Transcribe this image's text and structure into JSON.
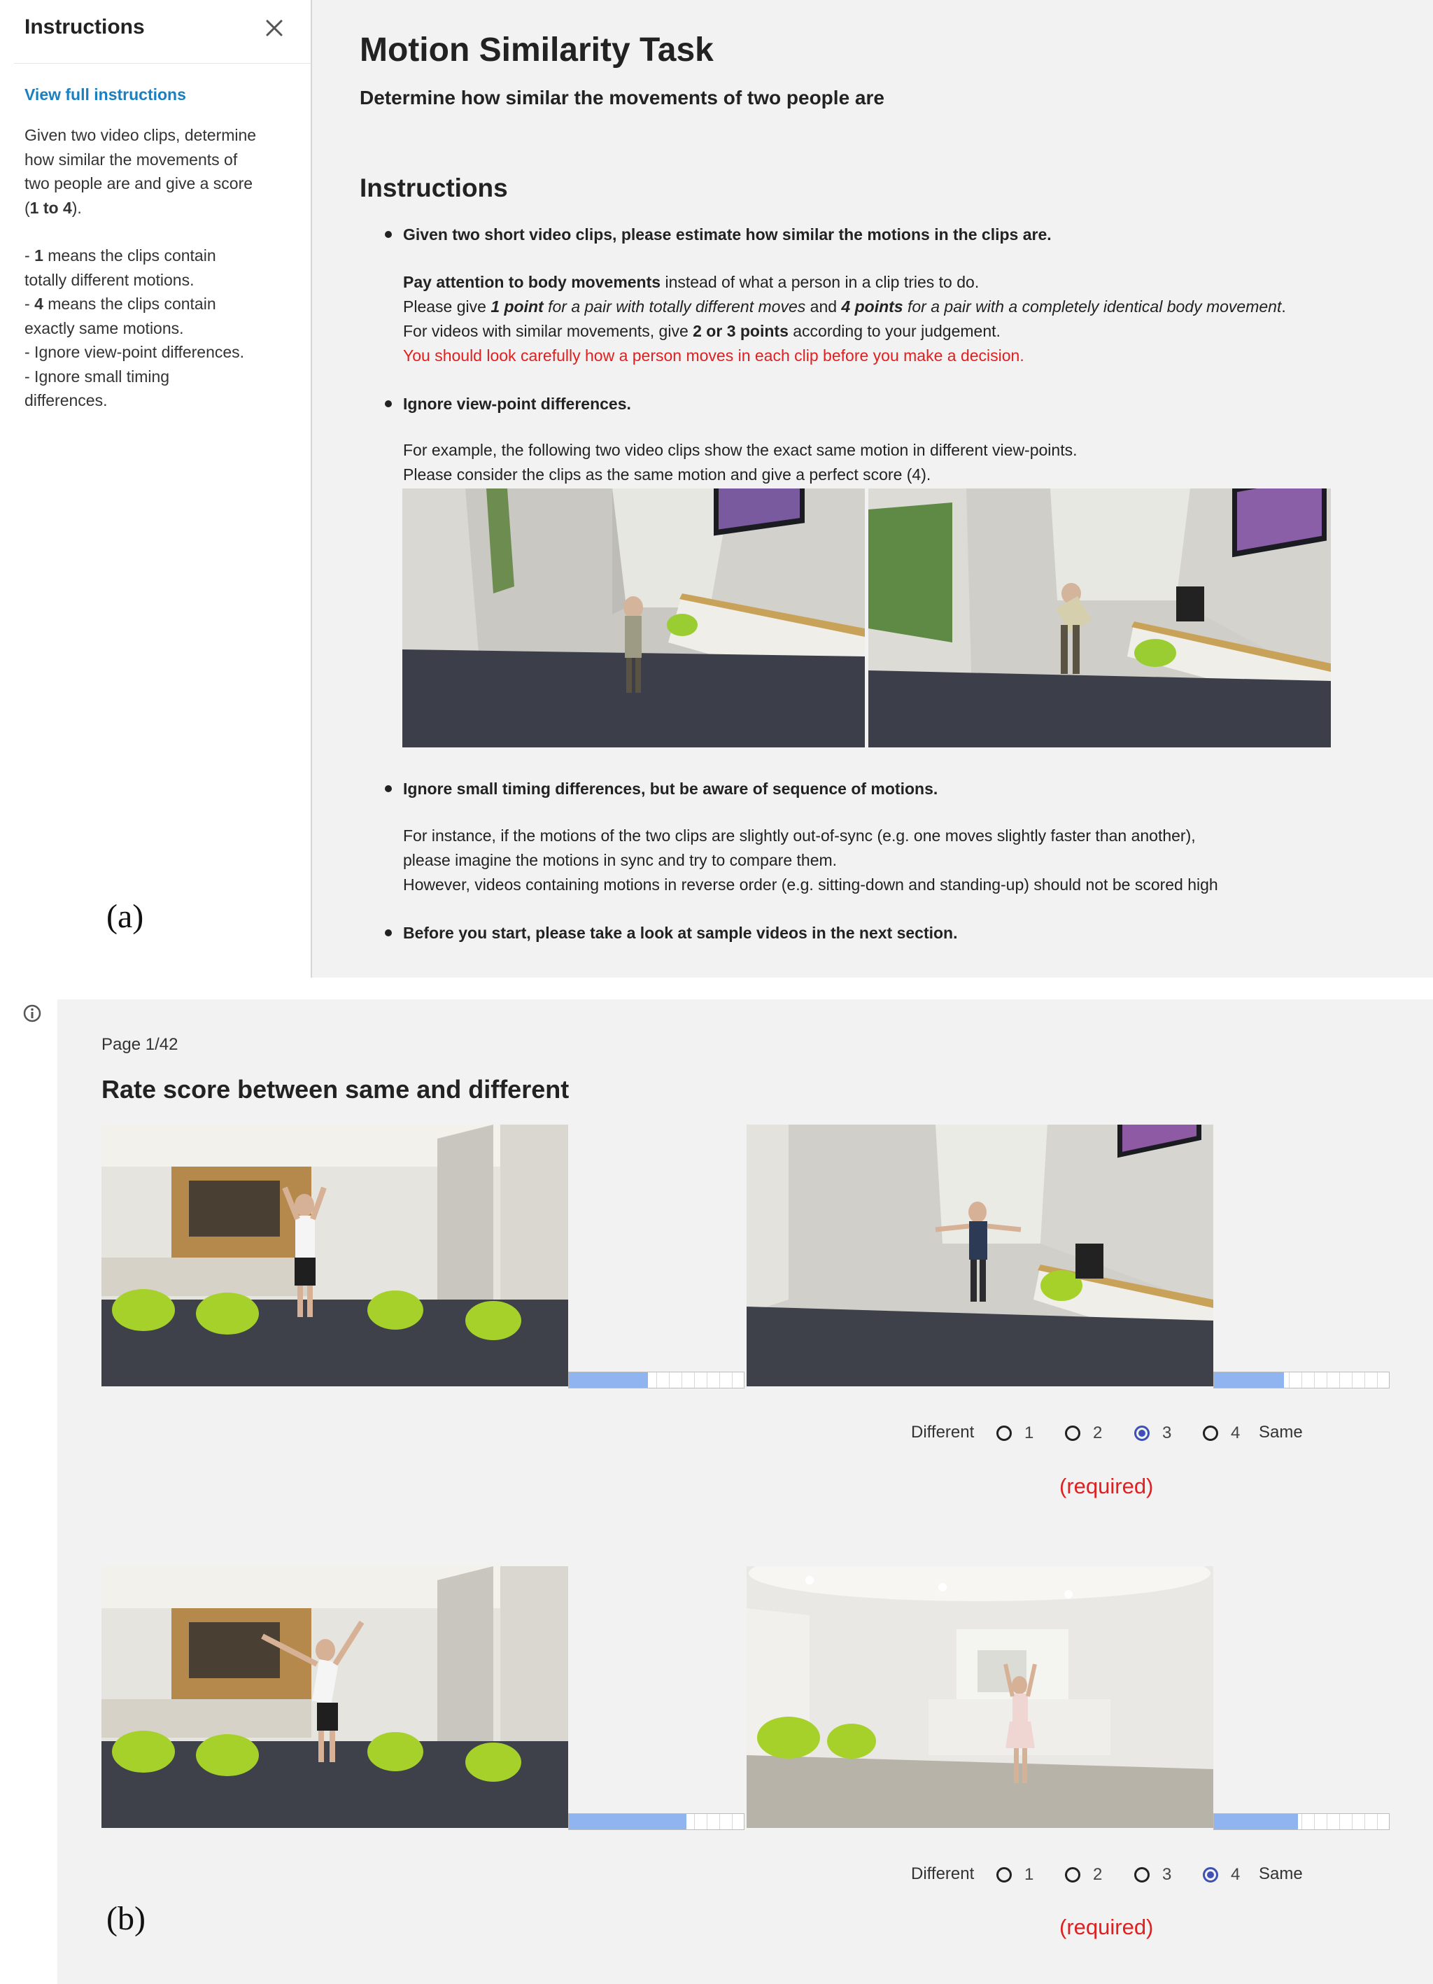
{
  "sidebar": {
    "title": "Instructions",
    "link": "View full instructions",
    "desc_l1": "Given two video clips, determine",
    "desc_l2": "how similar the movements of",
    "desc_l3": "two people are and give a score",
    "desc_l4_pre": "(",
    "desc_l4_bold": "1 to 4",
    "desc_l4_post": ").",
    "item1_pre": "- ",
    "item1_bold": "1",
    "item1_rest": " means the clips contain",
    "item1_cont": "totally different motions.",
    "item2_pre": "- ",
    "item2_bold": "4",
    "item2_rest": " means the clips contain",
    "item2_cont": "exactly same motions.",
    "item3": "- Ignore view-point differences.",
    "item4": "- Ignore small timing",
    "item4_cont": "differences."
  },
  "main": {
    "title": "Motion Similarity Task",
    "subtitle": "Determine how similar the movements of two people are",
    "instructions_heading": "Instructions",
    "b1_title": "Given two short video clips, please estimate how similar the motions in the clips are.",
    "b1_l1_bold": "Pay attention to body movements",
    "b1_l1_rest": " instead of what a person in a clip tries to do.",
    "b1_l2_a": "Please give ",
    "b1_l2_b": "1 point",
    "b1_l2_c": " for a pair with totally different moves",
    "b1_l2_d": " and ",
    "b1_l2_e": "4 points",
    "b1_l2_f": " for a pair with a completely identical body movement",
    "b1_l2_g": ".",
    "b1_l3_a": "For videos with similar movements, give ",
    "b1_l3_b": "2 or 3 points",
    "b1_l3_c": " according to your judgement.",
    "b1_l4": "You should look carefully how a person moves in each clip before you make a decision.",
    "b2_title": "Ignore view-point differences.",
    "b2_l1": "For example, the following two video clips show the exact same motion in different view-points.",
    "b2_l2": "Please consider the clips as the same motion and give a perfect score (4).",
    "b3_title": "Ignore small timing differences, but be aware of sequence of motions.",
    "b3_l1": "For instance, if the motions of the two clips are slightly out-of-sync (e.g. one moves slightly faster than another),",
    "b3_l2": "please imagine the motions in sync and try to compare them.",
    "b3_l3": "However, videos containing motions in reverse order (e.g. sitting-down and standing-up) should not be scored high",
    "b4_title": "Before you start, please take a look at sample videos in the next section."
  },
  "survey": {
    "page": "Page 1/42",
    "title": "Rate score between same and different",
    "scale_left": "Different",
    "scale_right": "Same",
    "options": [
      "1",
      "2",
      "3",
      "4"
    ],
    "required": "(required)",
    "q1": {
      "selected": "3",
      "progress_left": 0.45,
      "progress_right": 0.4
    },
    "q2": {
      "selected": "4",
      "progress_left": 0.67,
      "progress_right": 0.48
    }
  },
  "figure_labels": {
    "a": "(a)",
    "b": "(b)"
  },
  "colors": {
    "link": "#1a7fc1",
    "required": "#e02020",
    "radio_selected": "#3f51b5",
    "progress_fill": "#8fb4ef"
  }
}
